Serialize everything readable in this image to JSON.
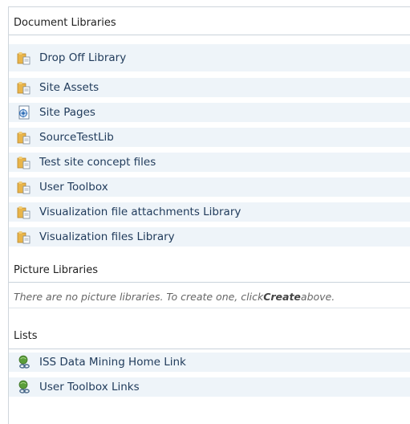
{
  "sections": {
    "document_libraries": {
      "title": "Document Libraries",
      "items": [
        {
          "label": "Drop Off Library",
          "icon": "document-library-icon"
        },
        {
          "label": "Site Assets",
          "icon": "document-library-icon"
        },
        {
          "label": "Site Pages",
          "icon": "wiki-page-library-icon"
        },
        {
          "label": "SourceTestLib",
          "icon": "document-library-icon"
        },
        {
          "label": "Test site concept files",
          "icon": "document-library-icon"
        },
        {
          "label": "User Toolbox",
          "icon": "document-library-icon"
        },
        {
          "label": "Visualization file attachments Library",
          "icon": "document-library-icon"
        },
        {
          "label": "Visualization files Library",
          "icon": "document-library-icon"
        }
      ]
    },
    "picture_libraries": {
      "title": "Picture Libraries",
      "empty_message_before": "There are no picture libraries. To create one, click ",
      "empty_message_link": "Create",
      "empty_message_after": " above."
    },
    "lists": {
      "title": "Lists",
      "items": [
        {
          "label": "ISS Data Mining Home Link",
          "icon": "links-list-icon"
        },
        {
          "label": "User Toolbox Links",
          "icon": "links-list-icon"
        }
      ]
    }
  },
  "colors": {
    "row_highlight": "#eef4f9",
    "link_text": "#1f3a5a",
    "border": "#c9d3db"
  }
}
